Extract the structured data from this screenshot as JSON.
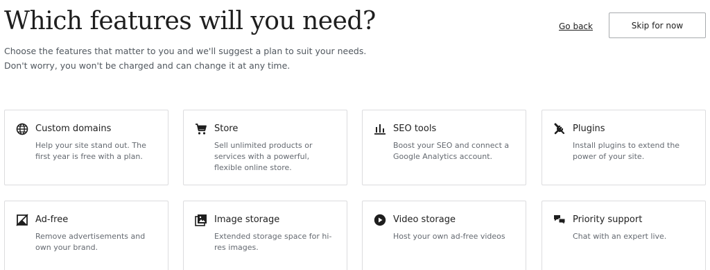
{
  "header": {
    "title": "Which features will you need?",
    "subtitle_line1": "Choose the features that matter to you and we'll suggest a plan to suit your needs.",
    "subtitle_line2": "Don't worry, you won't be charged and can change it at any time.",
    "go_back_label": "Go back",
    "skip_label": "Skip for now"
  },
  "features": [
    {
      "title": "Custom domains",
      "description": "Help your site stand out. The first year is free with a plan.",
      "icon": "globe-icon"
    },
    {
      "title": "Store",
      "description": "Sell unlimited products or services with a powerful, flexible online store.",
      "icon": "cart-icon"
    },
    {
      "title": "SEO tools",
      "description": "Boost your SEO and connect a Google Analytics account.",
      "icon": "bar-chart-icon"
    },
    {
      "title": "Plugins",
      "description": "Install plugins to extend the power of your site.",
      "icon": "tools-icon"
    },
    {
      "title": "Ad-free",
      "description": "Remove advertisements and own your brand.",
      "icon": "ad-free-icon"
    },
    {
      "title": "Image storage",
      "description": "Extended storage space for hi-res images.",
      "icon": "image-icon"
    },
    {
      "title": "Video storage",
      "description": "Host your own ad-free videos",
      "icon": "play-icon"
    },
    {
      "title": "Priority support",
      "description": "Chat with an expert live.",
      "icon": "chat-icon"
    }
  ],
  "colors": {
    "text": "#1e1e1e",
    "muted": "#646970",
    "border": "#dcdcde"
  }
}
